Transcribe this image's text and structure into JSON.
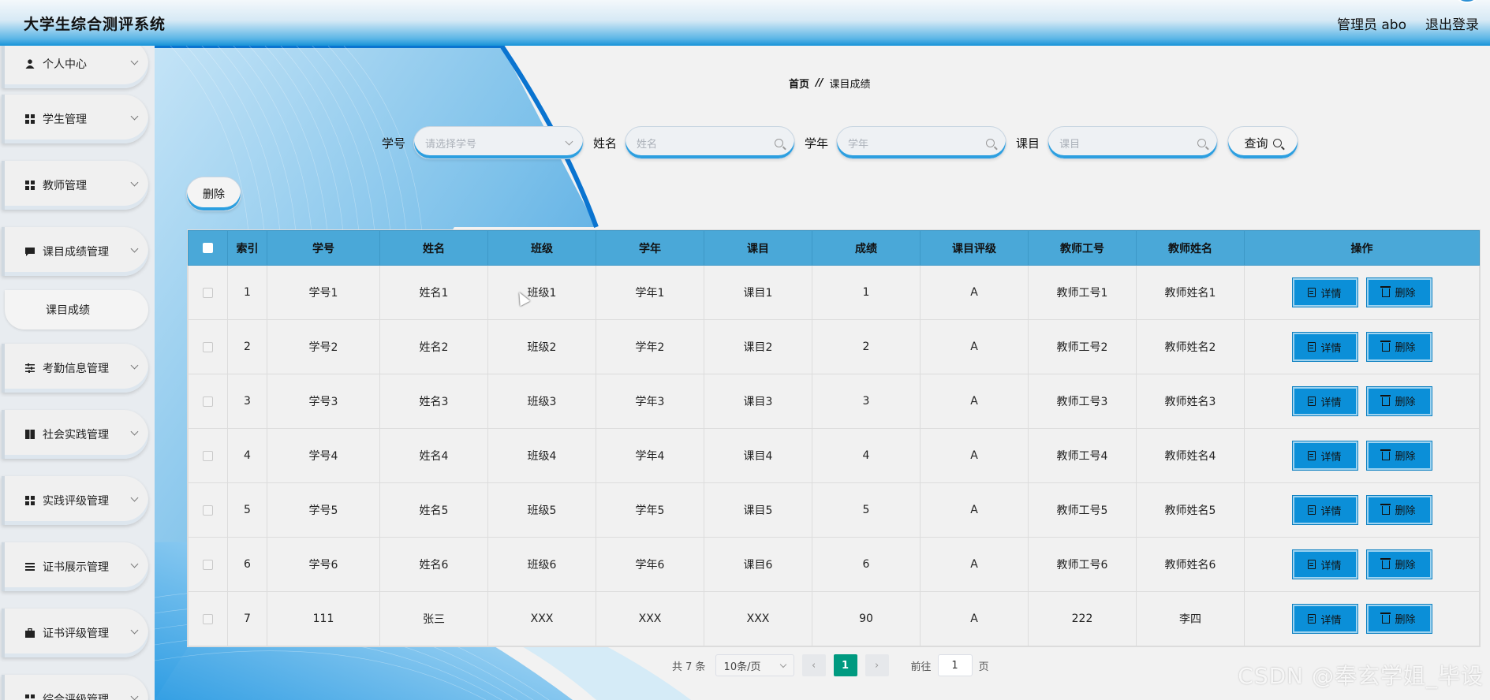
{
  "header": {
    "title": "大学生综合测评系统",
    "admin": "管理员 abo",
    "logout": "退出登录"
  },
  "sidebar": {
    "items": [
      {
        "label": "个人中心",
        "icon": "user-icon"
      },
      {
        "label": "学生管理",
        "icon": "grid-icon"
      },
      {
        "label": "教师管理",
        "icon": "grid-icon"
      },
      {
        "label": "课目成绩管理",
        "icon": "comment-icon"
      },
      {
        "label": "考勤信息管理",
        "icon": "sliders-icon"
      },
      {
        "label": "社会实践管理",
        "icon": "book-icon"
      },
      {
        "label": "实践评级管理",
        "icon": "grid-icon"
      },
      {
        "label": "证书展示管理",
        "icon": "list-icon"
      },
      {
        "label": "证书评级管理",
        "icon": "briefcase-icon"
      },
      {
        "label": "综合评级管理",
        "icon": "grid-icon"
      }
    ],
    "sub_item": "课目成绩"
  },
  "breadcrumb": {
    "home": "首页",
    "sep": "//",
    "current": "课目成绩"
  },
  "search": {
    "student_id_label": "学号",
    "student_id_placeholder": "请选择学号",
    "name_label": "姓名",
    "name_placeholder": "姓名",
    "year_label": "学年",
    "year_placeholder": "学年",
    "subject_label": "课目",
    "subject_placeholder": "课目",
    "query_button": "查询"
  },
  "delete_button": "删除",
  "table": {
    "headers": [
      "索引",
      "学号",
      "姓名",
      "班级",
      "学年",
      "课目",
      "成绩",
      "课目评级",
      "教师工号",
      "教师姓名",
      "操作"
    ],
    "rows": [
      [
        "1",
        "学号1",
        "姓名1",
        "班级1",
        "学年1",
        "课目1",
        "1",
        "A",
        "教师工号1",
        "教师姓名1"
      ],
      [
        "2",
        "学号2",
        "姓名2",
        "班级2",
        "学年2",
        "课目2",
        "2",
        "A",
        "教师工号2",
        "教师姓名2"
      ],
      [
        "3",
        "学号3",
        "姓名3",
        "班级3",
        "学年3",
        "课目3",
        "3",
        "A",
        "教师工号3",
        "教师姓名3"
      ],
      [
        "4",
        "学号4",
        "姓名4",
        "班级4",
        "学年4",
        "课目4",
        "4",
        "A",
        "教师工号4",
        "教师姓名4"
      ],
      [
        "5",
        "学号5",
        "姓名5",
        "班级5",
        "学年5",
        "课目5",
        "5",
        "A",
        "教师工号5",
        "教师姓名5"
      ],
      [
        "6",
        "学号6",
        "姓名6",
        "班级6",
        "学年6",
        "课目6",
        "6",
        "A",
        "教师工号6",
        "教师姓名6"
      ],
      [
        "7",
        "111",
        "张三",
        "XXX",
        "XXX",
        "XXX",
        "90",
        "A",
        "222",
        "李四"
      ]
    ],
    "detail_label": "详情",
    "delete_label": "删除"
  },
  "pagination": {
    "total": "共 7 条",
    "page_size": "10条/页",
    "prev": "‹",
    "current_page": "1",
    "next": "›",
    "goto_label": "前往",
    "goto_value": "1",
    "goto_suffix": "页"
  },
  "watermark": "CSDN @奉玄学姐_毕设",
  "colors": {
    "header_blue": "#1793d8",
    "table_header": "#4aa8d8",
    "action_button": "#0b8fd8",
    "active_page": "#009a80"
  }
}
